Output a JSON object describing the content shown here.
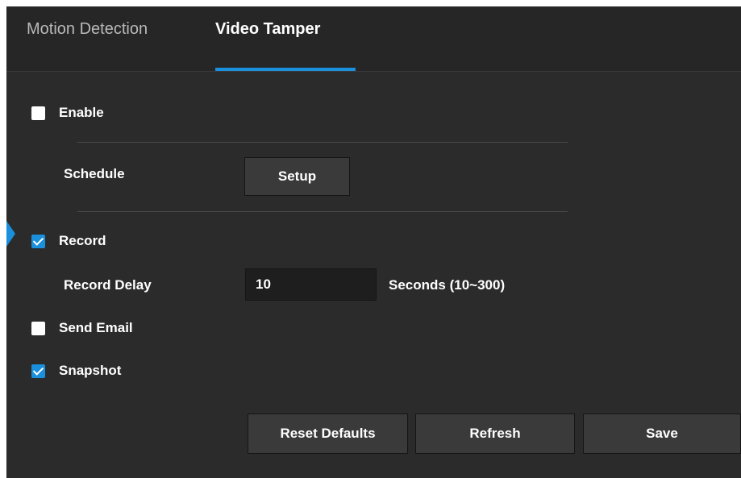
{
  "tabs": [
    {
      "label": "Motion Detection",
      "active": false
    },
    {
      "label": "Video Tamper",
      "active": true
    }
  ],
  "colors": {
    "accent": "#1a8fdc",
    "background": "#2b2b2b",
    "button": "#3a3a3a"
  },
  "form": {
    "enable": {
      "label": "Enable",
      "checked": false
    },
    "schedule": {
      "label": "Schedule",
      "button_label": "Setup"
    },
    "record": {
      "label": "Record",
      "checked": true
    },
    "record_delay": {
      "label": "Record Delay",
      "value": "10",
      "unit": "Seconds (10~300)"
    },
    "send_email": {
      "label": "Send Email",
      "checked": false
    },
    "snapshot": {
      "label": "Snapshot",
      "checked": true
    }
  },
  "buttons": {
    "reset_defaults": "Reset Defaults",
    "refresh": "Refresh",
    "save": "Save"
  }
}
